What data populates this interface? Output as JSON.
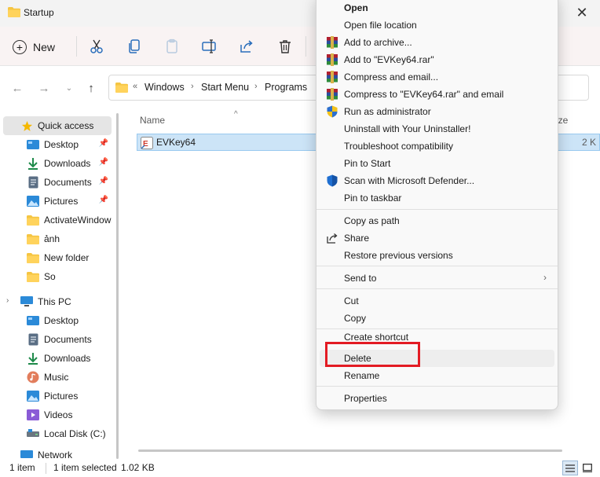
{
  "window": {
    "title": "Startup"
  },
  "toolbar": {
    "new_label": "New"
  },
  "address": {
    "prefix": "«",
    "crumbs": [
      "Windows",
      "Start Menu",
      "Programs"
    ]
  },
  "nav": {
    "quick_access": "Quick access",
    "quick_items": [
      "Desktop",
      "Downloads",
      "Documents",
      "Pictures",
      "ActivateWindows",
      "ảnh",
      "New folder",
      "So"
    ],
    "this_pc": "This PC",
    "pc_items": [
      "Desktop",
      "Documents",
      "Downloads",
      "Music",
      "Pictures",
      "Videos",
      "Local Disk (C:)"
    ],
    "network": "Network"
  },
  "content": {
    "col_name": "Name",
    "col_size": "ize",
    "file": {
      "name": "EVKey64",
      "size": "2 K"
    }
  },
  "status": {
    "items": "1 item",
    "selected": "1 item selected",
    "size": "1.02 KB"
  },
  "context_menu": {
    "items": [
      "Open",
      "Open file location",
      "Add to archive...",
      "Add to \"EVKey64.rar\"",
      "Compress and email...",
      "Compress to \"EVKey64.rar\" and email",
      "Run as administrator",
      "Uninstall with Your Uninstaller!",
      "Troubleshoot compatibility",
      "Pin to Start",
      "Scan with Microsoft Defender...",
      "Pin to taskbar",
      "Copy as path",
      "Share",
      "Restore previous versions",
      "Send to",
      "Cut",
      "Copy",
      "Create shortcut",
      "Delete",
      "Rename",
      "Properties"
    ]
  },
  "colors": {
    "selection": "#cce4f7",
    "highlight_border": "#e31b23",
    "folder": "#f5c542"
  },
  "icons": [
    "folder-icon",
    "plus-icon",
    "cut-icon",
    "copy-icon",
    "paste-icon",
    "rename-icon",
    "share-icon",
    "delete-icon",
    "back-icon",
    "forward-icon",
    "up-icon",
    "star-icon",
    "desktop-icon",
    "downloads-icon",
    "documents-icon",
    "pictures-icon",
    "pc-icon",
    "music-icon",
    "videos-icon",
    "disk-icon",
    "winrar-icon",
    "shield-icon",
    "defender-icon",
    "share-icon"
  ]
}
